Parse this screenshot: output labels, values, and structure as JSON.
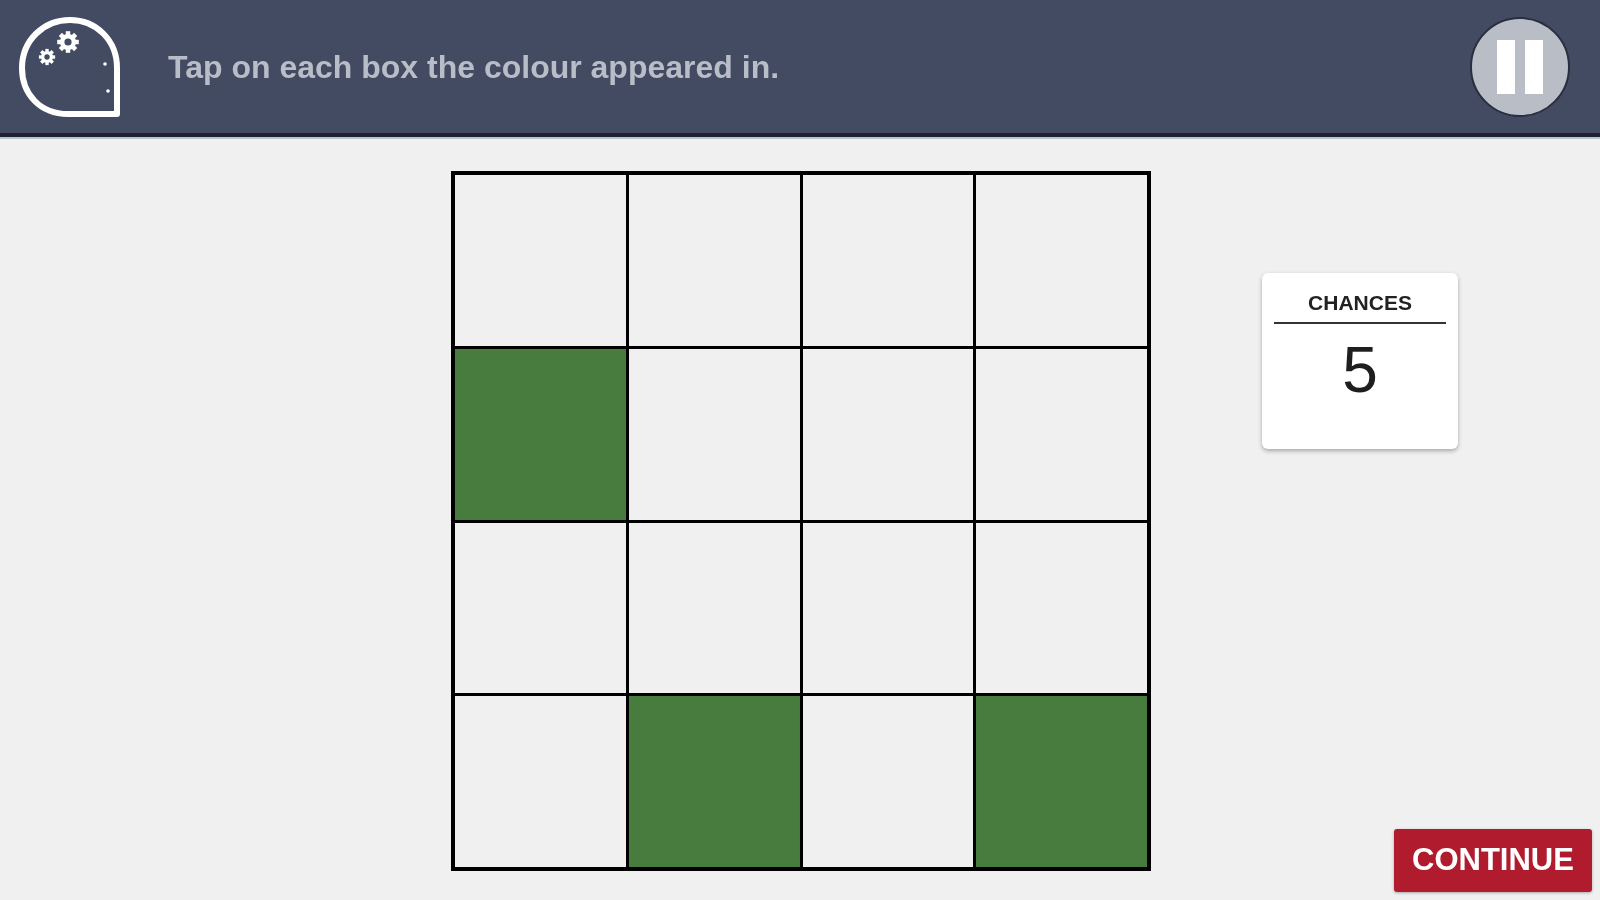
{
  "header": {
    "title": "Tap on each box the colour appeared in."
  },
  "grid": {
    "rows": [
      {
        "cells": [
          {
            "filled": false
          },
          {
            "filled": false
          },
          {
            "filled": false
          },
          {
            "filled": false
          }
        ]
      },
      {
        "cells": [
          {
            "filled": true
          },
          {
            "filled": false
          },
          {
            "filled": false
          },
          {
            "filled": false
          }
        ]
      },
      {
        "cells": [
          {
            "filled": false
          },
          {
            "filled": false
          },
          {
            "filled": false
          },
          {
            "filled": false
          }
        ]
      },
      {
        "cells": [
          {
            "filled": false
          },
          {
            "filled": true
          },
          {
            "filled": false
          },
          {
            "filled": true
          }
        ]
      }
    ]
  },
  "chances": {
    "label": "CHANCES",
    "value": "5"
  },
  "continue_button": {
    "label": "CONTINUE"
  }
}
